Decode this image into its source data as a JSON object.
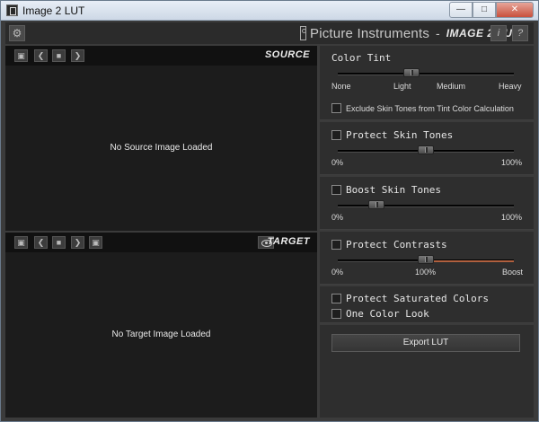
{
  "window": {
    "title": "Image 2 LUT"
  },
  "header": {
    "brand": "Picture Instruments",
    "dash": "-",
    "product": "IMAGE 2 LUT",
    "info_label": "i",
    "help_label": "?",
    "settings_icon": "gear-icon"
  },
  "source": {
    "title": "SOURCE",
    "empty_message": "No Source Image Loaded"
  },
  "target": {
    "title": "TARGET",
    "empty_message": "No Target Image Loaded"
  },
  "color_tint": {
    "title": "Color Tint",
    "ticks": [
      "None",
      "Light",
      "Medium",
      "Heavy"
    ],
    "value_fraction": 0.42,
    "exclude_label": "Exclude Skin Tones from Tint Color Calculation",
    "exclude_checked": false
  },
  "protect_skin": {
    "label": "Protect Skin Tones",
    "checked": false,
    "min_label": "0%",
    "max_label": "100%",
    "value_fraction": 0.5
  },
  "boost_skin": {
    "label": "Boost Skin Tones",
    "checked": false,
    "min_label": "0%",
    "max_label": "100%",
    "value_fraction": 0.22
  },
  "protect_contrast": {
    "label": "Protect Contrasts",
    "checked": false,
    "min_label": "0%",
    "mid_label": "100%",
    "max_label": "Boost",
    "value_fraction": 0.5
  },
  "protect_saturated": {
    "label": "Protect Saturated Colors",
    "checked": false
  },
  "one_color": {
    "label": "One Color Look",
    "checked": false
  },
  "export": {
    "label": "Export LUT"
  },
  "colors": {
    "panel_bg": "#2e2e2e",
    "viewer_bg": "#1c1c1c",
    "accent_track": "#b0603f"
  }
}
